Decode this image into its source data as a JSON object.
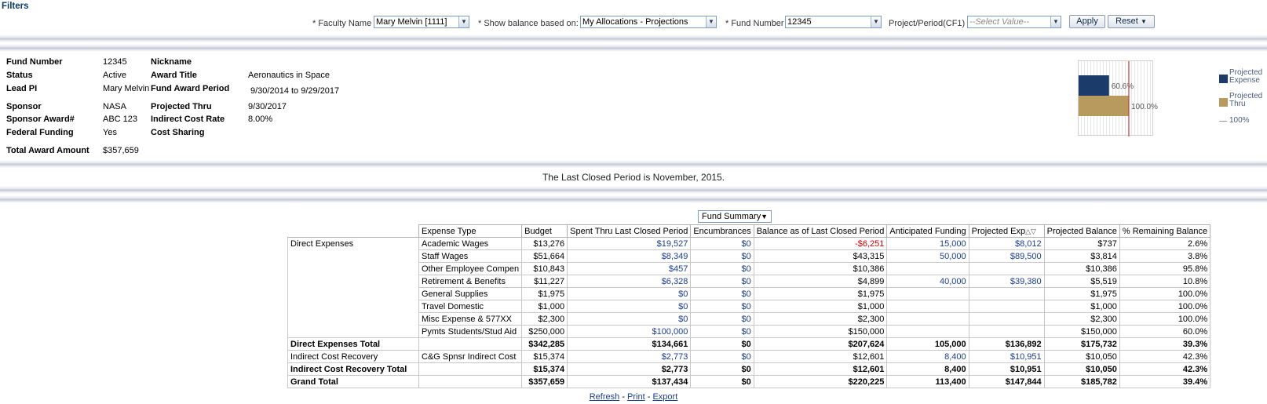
{
  "filters": {
    "title": "Filters",
    "faculty_label": "* Faculty Name",
    "faculty_value": "Mary Melvin [1111]",
    "balance_label": "* Show balance based on:",
    "balance_value": "My Allocations - Projections",
    "fund_label": "* Fund Number",
    "fund_value": "12345",
    "project_label": "Project/Period(CF1)",
    "project_placeholder": "--Select Value--",
    "apply_label": "Apply",
    "reset_label": "Reset"
  },
  "fund_info": {
    "left": [
      {
        "label": "Fund Number",
        "value": "12345"
      },
      {
        "label": "Status",
        "value": "Active"
      },
      {
        "label": "Lead PI",
        "value": "Mary Melvin"
      },
      {
        "label": "Sponsor",
        "value": "NASA"
      },
      {
        "label": "Sponsor Award#",
        "value": "ABC 123"
      },
      {
        "label": "Federal Funding",
        "value": "Yes"
      },
      {
        "label": "Total Award Amount",
        "value": "$357,659"
      }
    ],
    "right": [
      {
        "label": "Nickname",
        "value": ""
      },
      {
        "label": "Award Title",
        "value": "Aeronautics in Space"
      },
      {
        "label": "Fund Award Period",
        "value": "9/30/2014 to 9/29/2017"
      },
      {
        "label": "Projected Thru",
        "value": "9/30/2017"
      },
      {
        "label": "Indirect Cost Rate",
        "value": "8.00%"
      },
      {
        "label": "Cost Sharing",
        "value": ""
      }
    ]
  },
  "chart_data": {
    "type": "bar",
    "orientation": "horizontal",
    "categories": [
      "Projected Expense",
      "Projected Thru"
    ],
    "values": [
      60.6,
      100.0
    ],
    "data_labels": [
      "60.6%",
      "100.0%"
    ],
    "colors": [
      "#1b3c6a",
      "#b89a5e"
    ],
    "reference_line": {
      "value": 100,
      "label": "100%",
      "color": "#cc2222"
    },
    "legend": [
      "Projected Expense",
      "Projected Thru",
      "100%"
    ],
    "legend_position": "right",
    "xlim": [
      0,
      150
    ],
    "grid": true
  },
  "banner": "The Last Closed Period is November, 2015.",
  "summary": {
    "view_select": "Fund Summary",
    "headers": [
      "",
      "Expense Type",
      "Budget",
      "Spent Thru Last Closed Period",
      "Encumbrances",
      "Balance as of Last Closed Period",
      "Anticipated Funding",
      "Projected Exp",
      "Projected Balance",
      "% Remaining Balance"
    ],
    "rows": [
      {
        "group": "Direct Expenses",
        "type": "Academic Wages",
        "budget": "$13,276",
        "spent": "$19,527",
        "enc": "$0",
        "bal": "-$6,251",
        "antic": "15,000",
        "projexp": "$8,012",
        "projbal": "$737",
        "pct": "2.6%"
      },
      {
        "group": "",
        "type": "Staff Wages",
        "budget": "$51,664",
        "spent": "$8,349",
        "enc": "$0",
        "bal": "$43,315",
        "antic": "50,000",
        "projexp": "$89,500",
        "projbal": "$3,814",
        "pct": "3.8%"
      },
      {
        "group": "",
        "type": "Other Employee Compen",
        "budget": "$10,843",
        "spent": "$457",
        "enc": "$0",
        "bal": "$10,386",
        "antic": "",
        "projexp": "",
        "projbal": "$10,386",
        "pct": "95.8%"
      },
      {
        "group": "",
        "type": "Retirement & Benefits",
        "budget": "$11,227",
        "spent": "$6,328",
        "enc": "$0",
        "bal": "$4,899",
        "antic": "40,000",
        "projexp": "$39,380",
        "projbal": "$5,519",
        "pct": "10.8%"
      },
      {
        "group": "",
        "type": "General Supplies",
        "budget": "$1,975",
        "spent": "$0",
        "enc": "$0",
        "bal": "$1,975",
        "antic": "",
        "projexp": "",
        "projbal": "$1,975",
        "pct": "100.0%"
      },
      {
        "group": "",
        "type": "Travel Domestic",
        "budget": "$1,000",
        "spent": "$0",
        "enc": "$0",
        "bal": "$1,000",
        "antic": "",
        "projexp": "",
        "projbal": "$1,000",
        "pct": "100.0%"
      },
      {
        "group": "",
        "type": "Misc Expense & 577XX",
        "budget": "$2,300",
        "spent": "$0",
        "enc": "$0",
        "bal": "$2,300",
        "antic": "",
        "projexp": "",
        "projbal": "$2,300",
        "pct": "100.0%"
      },
      {
        "group": "",
        "type": "Pymts Students/Stud Aid",
        "budget": "$250,000",
        "spent": "$100,000",
        "enc": "$0",
        "bal": "$150,000",
        "antic": "",
        "projexp": "",
        "projbal": "$150,000",
        "pct": "60.0%"
      }
    ],
    "direct_total": {
      "label": "Direct Expenses Total",
      "budget": "$342,285",
      "spent": "$134,661",
      "enc": "$0",
      "bal": "$207,624",
      "antic": "105,000",
      "projexp": "$136,892",
      "projbal": "$175,732",
      "pct": "39.3%"
    },
    "icr_row": {
      "group": "Indirect Cost Recovery",
      "type": "C&G Spnsr Indirect Cost",
      "budget": "$15,374",
      "spent": "$2,773",
      "enc": "$0",
      "bal": "$12,601",
      "antic": "8,400",
      "projexp": "$10,951",
      "projbal": "$10,050",
      "pct": "42.3%"
    },
    "icr_total": {
      "label": "Indirect Cost Recovery Total",
      "budget": "$15,374",
      "spent": "$2,773",
      "enc": "$0",
      "bal": "$12,601",
      "antic": "8,400",
      "projexp": "$10,951",
      "projbal": "$10,050",
      "pct": "42.3%"
    },
    "grand_total": {
      "label": "Grand Total",
      "budget": "$357,659",
      "spent": "$137,434",
      "enc": "$0",
      "bal": "$220,225",
      "antic": "113,400",
      "projexp": "$147,844",
      "projbal": "$185,782",
      "pct": "39.4%"
    }
  },
  "footer_links": {
    "refresh": "Refresh",
    "print": "Print",
    "export": "Export"
  }
}
